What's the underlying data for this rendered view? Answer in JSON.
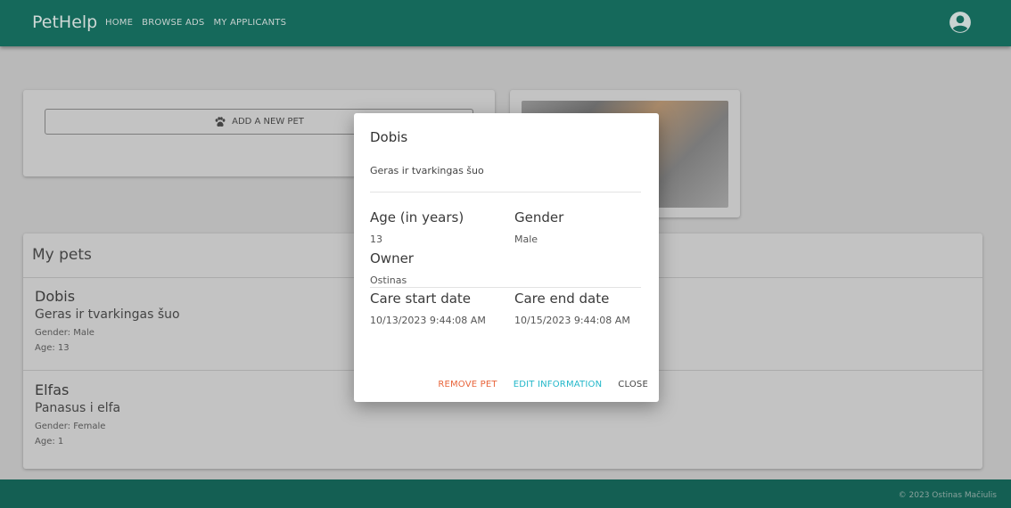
{
  "header": {
    "brand": "PetHelp",
    "nav": [
      "HOME",
      "BROWSE ADS",
      "MY APPLICANTS"
    ]
  },
  "add_card": {
    "button_label": "ADD A NEW PET"
  },
  "pets_section": {
    "title": "My pets",
    "pets": [
      {
        "name": "Dobis",
        "description": "Geras ir tvarkingas šuo",
        "gender": "Gender: Male",
        "age": "Age: 13"
      },
      {
        "name": "Elfas",
        "description": "Panasus i elfa",
        "gender": "Gender: Female",
        "age": "Age: 1"
      }
    ]
  },
  "modal": {
    "title": "Dobis",
    "description": "Geras ir tvarkingas šuo",
    "age_label": "Age (in years)",
    "age_value": "13",
    "gender_label": "Gender",
    "gender_value": "Male",
    "owner_label": "Owner",
    "owner_value": "Ostinas",
    "care_start_label": "Care start date",
    "care_start_value": "10/13/2023 9:44:08 AM",
    "care_end_label": "Care end date",
    "care_end_value": "10/15/2023 9:44:08 AM",
    "actions": {
      "remove": "REMOVE PET",
      "edit": "EDIT INFORMATION",
      "close": "CLOSE"
    }
  },
  "footer": {
    "text": "© 2023 Ostinas Mačiulis"
  },
  "colors": {
    "header": "#15695b",
    "remove": "#e8643a",
    "edit": "#22b7c9"
  }
}
